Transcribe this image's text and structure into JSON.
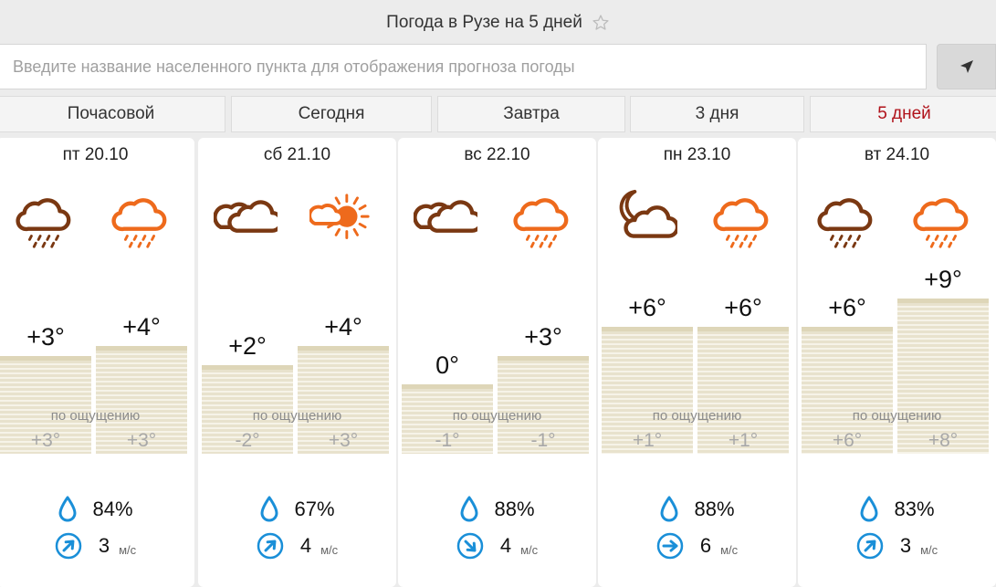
{
  "page": {
    "title": "Погода в Рузе на 5 дней"
  },
  "search": {
    "placeholder": "Введите название населенного пункта для отображения прогноза погоды",
    "value": ""
  },
  "tabs": [
    {
      "label": "Почасовой",
      "active": false
    },
    {
      "label": "Сегодня",
      "active": false
    },
    {
      "label": "Завтра",
      "active": false
    },
    {
      "label": "3 дня",
      "active": false
    },
    {
      "label": "5 дней",
      "active": true
    }
  ],
  "colors": {
    "active_tab": "#b0121a",
    "icon_dark": "#7a3812",
    "icon_orange": "#ee6a1c",
    "wind_blue": "#1a8fd8",
    "bar": "#e8e2cd"
  },
  "feels_label": "по ощущению",
  "wind_unit": "м/с",
  "days": [
    {
      "date": "пт 20.10",
      "night": {
        "temp": "+3°",
        "value": 3,
        "feels": "+3°",
        "icon": "cloud-rain-icon"
      },
      "day": {
        "temp": "+4°",
        "value": 4,
        "feels": "+3°",
        "icon": "cloud-rain-icon"
      },
      "humidity": "84%",
      "wind_speed": "3",
      "wind_direction": "north-east-arrow"
    },
    {
      "date": "сб 21.10",
      "night": {
        "temp": "+2°",
        "value": 2,
        "feels": "-2°",
        "icon": "clouds-icon"
      },
      "day": {
        "temp": "+4°",
        "value": 4,
        "feels": "+3°",
        "icon": "sun-cloud-icon"
      },
      "humidity": "67%",
      "wind_speed": "4",
      "wind_direction": "north-east-arrow"
    },
    {
      "date": "вс 22.10",
      "night": {
        "temp": "0°",
        "value": 0,
        "feels": "-1°",
        "icon": "clouds-icon"
      },
      "day": {
        "temp": "+3°",
        "value": 3,
        "feels": "-1°",
        "icon": "cloud-rain-icon"
      },
      "humidity": "88%",
      "wind_speed": "4",
      "wind_direction": "south-east-arrow"
    },
    {
      "date": "пн 23.10",
      "night": {
        "temp": "+6°",
        "value": 6,
        "feels": "+1°",
        "icon": "moon-cloud-icon"
      },
      "day": {
        "temp": "+6°",
        "value": 6,
        "feels": "+1°",
        "icon": "cloud-rain-icon"
      },
      "humidity": "88%",
      "wind_speed": "6",
      "wind_direction": "east-arrow"
    },
    {
      "date": "вт 24.10",
      "night": {
        "temp": "+6°",
        "value": 6,
        "feels": "+6°",
        "icon": "cloud-rain-icon"
      },
      "day": {
        "temp": "+9°",
        "value": 9,
        "feels": "+8°",
        "icon": "cloud-rain-icon"
      },
      "humidity": "83%",
      "wind_speed": "3",
      "wind_direction": "north-east-arrow"
    }
  ]
}
